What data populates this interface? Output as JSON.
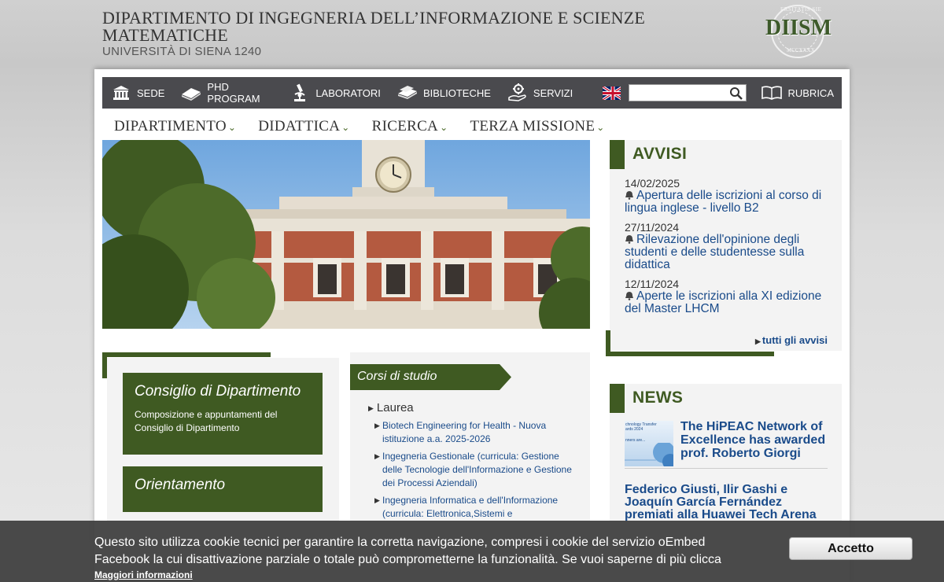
{
  "header": {
    "title": "DIPARTIMENTO DI INGEGNERIA DELL’INFORMAZIONE E SCIENZE MATEMATICHE",
    "subtitle": "UNIVERSITÀ DI SIENA 1240",
    "logo_text": "DIISM",
    "logo_arc_top": "ERSITATIS SIE",
    "logo_arc_bottom": "MCCXXXX"
  },
  "topnav": {
    "items": [
      {
        "label": "SEDE",
        "icon": "building-icon"
      },
      {
        "label": "PHD PROGRAM",
        "icon": "book-icon"
      },
      {
        "label": "LABORATORI",
        "icon": "microscope-icon"
      },
      {
        "label": "BIBLIOTECHE",
        "icon": "books-icon"
      },
      {
        "label": "SERVIZI",
        "icon": "hand-gear-icon"
      }
    ],
    "search_value": "",
    "rubrica": "RUBRICA"
  },
  "mainmenu": {
    "items": [
      "DIPARTIMENTO",
      "DIDATTICA",
      "RICERCA",
      "TERZA MISSIONE"
    ]
  },
  "avvisi": {
    "title": "AVVISI",
    "items": [
      {
        "date": "14/02/2025",
        "text": "Apertura delle iscrizioni al corso di lingua inglese - livello B2"
      },
      {
        "date": "27/11/2024",
        "text": "Rilevazione dell'opinione degli studenti e delle studentesse sulla didattica"
      },
      {
        "date": "12/11/2024",
        "text": "Aperte le iscrizioni alla XI edizione del Master LHCM"
      }
    ],
    "all_link": "tutti gli avvisi"
  },
  "left_boxes": {
    "consiglio_title": "Consiglio di Dipartimento",
    "consiglio_desc": "Composizione e appuntamenti del Consiglio di Dipartimento",
    "orientamento_title": "Orientamento"
  },
  "corsi": {
    "title": "Corsi di studio",
    "group": "Laurea",
    "items": [
      "Biotech Engineering for Health - Nuova istituzione a.a. 2025-2026",
      "Ingegneria Gestionale (curricula: Gestione delle Tecnologie dell'Informazione e Gestione dei Processi Aziendali)",
      "Ingegneria Informatica e dell'Informazione (curricula: Elettronica,Sistemi e"
    ]
  },
  "news": {
    "title": "NEWS",
    "img_line1": "chnology Transfer",
    "img_line2": "ards 2024",
    "img_line3": "nners are...",
    "item1": "The HiPEAC Network of Excellence has awarded prof. Roberto Giorgi",
    "item2": "Federico Giusti, Ilir Gashi e Joaquín García Fernández premiati alla Huawei Tech Arena"
  },
  "cookie": {
    "text": "Questo sito utilizza cookie tecnici per garantire la corretta navigazione, compresi i cookie del servizio oEmbed Facebook la cui disattivazione parziale o totale può comprometterne la funzionalità. Se vuoi saperne di più clicca",
    "link": "Maggiori informazioni",
    "accept": "Accetto"
  },
  "colors": {
    "accent_green": "#3f5a22",
    "link_blue": "#1a4b8a",
    "nav_dark": "#4a4a4e"
  }
}
